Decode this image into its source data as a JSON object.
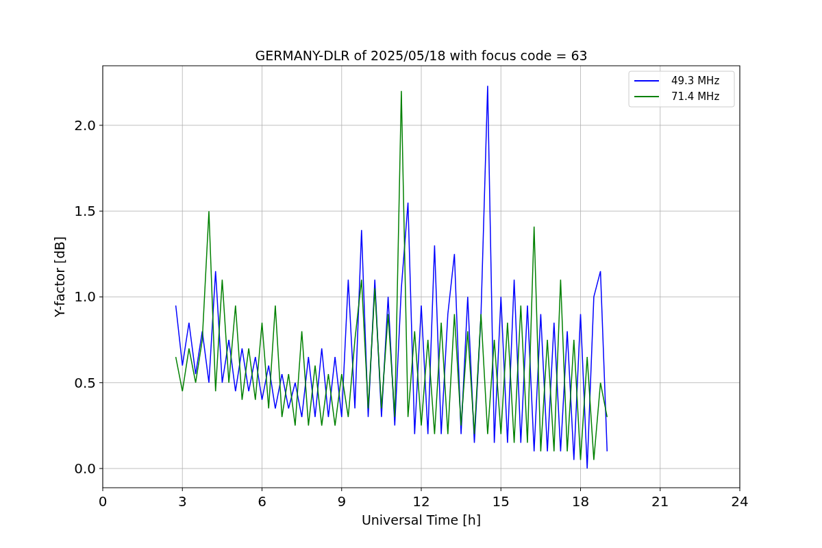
{
  "chart_data": {
    "type": "line",
    "title": "GERMANY-DLR of 2025/05/18 with focus code = 63",
    "xlabel": "Universal Time [h]",
    "ylabel": "Y-factor [dB]",
    "x": [
      2.75,
      3,
      3.25,
      3.5,
      3.75,
      4,
      4.25,
      4.5,
      4.75,
      5,
      5.25,
      5.5,
      5.75,
      6,
      6.25,
      6.5,
      6.75,
      7,
      7.25,
      7.5,
      7.75,
      8,
      8.25,
      8.5,
      8.75,
      9,
      9.25,
      9.5,
      9.75,
      10,
      10.25,
      10.5,
      10.75,
      11,
      11.25,
      11.5,
      11.75,
      12,
      12.25,
      12.5,
      12.75,
      13,
      13.25,
      13.5,
      13.75,
      14,
      14.25,
      14.5,
      14.75,
      15,
      15.25,
      15.5,
      15.75,
      16,
      16.25,
      16.5,
      16.75,
      17,
      17.25,
      17.5,
      17.75,
      18,
      18.25,
      18.5,
      18.75,
      19
    ],
    "series": [
      {
        "name": "49.3 MHz",
        "color": "#0000ff",
        "values": [
          0.95,
          0.6,
          0.85,
          0.55,
          0.8,
          0.5,
          1.15,
          0.5,
          0.75,
          0.45,
          0.7,
          0.45,
          0.65,
          0.4,
          0.6,
          0.35,
          0.55,
          0.35,
          0.5,
          0.3,
          0.65,
          0.3,
          0.7,
          0.3,
          0.65,
          0.3,
          1.1,
          0.35,
          1.39,
          0.3,
          1.1,
          0.3,
          1.0,
          0.25,
          1.05,
          1.55,
          0.2,
          0.95,
          0.2,
          1.3,
          0.2,
          0.9,
          1.25,
          0.2,
          1.0,
          0.15,
          0.9,
          2.23,
          0.15,
          1.0,
          0.15,
          1.1,
          0.15,
          0.95,
          0.1,
          0.9,
          0.1,
          0.85,
          0.1,
          0.8,
          0.05,
          0.9,
          0.0,
          1.0,
          1.15,
          0.1
        ]
      },
      {
        "name": "71.4 MHz",
        "color": "#008000",
        "values": [
          0.65,
          0.45,
          0.7,
          0.5,
          0.75,
          1.5,
          0.45,
          1.1,
          0.5,
          0.95,
          0.4,
          0.7,
          0.4,
          0.85,
          0.35,
          0.95,
          0.3,
          0.55,
          0.25,
          0.8,
          0.25,
          0.6,
          0.25,
          0.55,
          0.25,
          0.55,
          0.3,
          0.75,
          1.1,
          0.35,
          1.05,
          0.35,
          0.9,
          0.3,
          2.2,
          0.3,
          0.8,
          0.25,
          0.75,
          0.2,
          0.85,
          0.2,
          0.9,
          0.25,
          0.8,
          0.2,
          0.9,
          0.2,
          0.75,
          0.2,
          0.85,
          0.15,
          0.95,
          0.15,
          1.41,
          0.1,
          0.75,
          0.1,
          1.1,
          0.1,
          0.75,
          0.05,
          0.65,
          0.05,
          0.5,
          0.3
        ]
      }
    ],
    "grid": true,
    "legend": true,
    "xlim": [
      0,
      24
    ],
    "ylim": [
      -0.112,
      2.347
    ],
    "xticks": [
      0,
      3,
      6,
      9,
      12,
      15,
      18,
      21,
      24
    ],
    "yticks": [
      {
        "value": 0,
        "label": "0.0"
      },
      {
        "value": 0.5,
        "label": "0.5"
      },
      {
        "value": 1,
        "label": "1.0"
      },
      {
        "value": 1.5,
        "label": "1.5"
      },
      {
        "value": 2,
        "label": "2.0"
      }
    ]
  }
}
